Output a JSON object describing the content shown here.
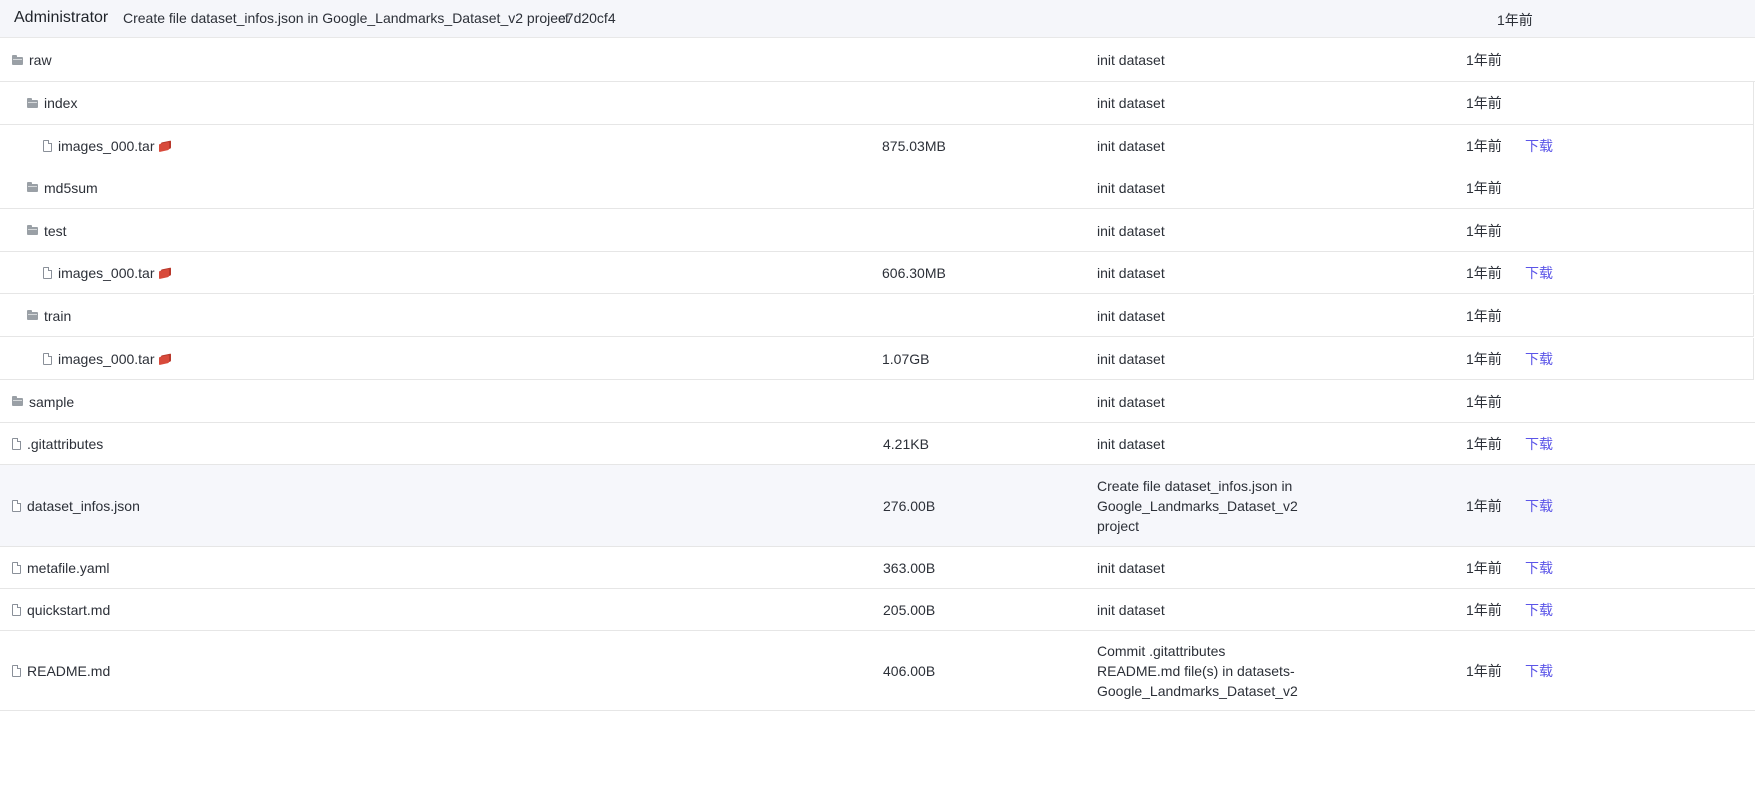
{
  "latest_commit": {
    "author": "Administrator",
    "message": "Create file dataset_infos.json in Google_Landmarks_Dataset_v2 project",
    "hash": "e7d20cf4",
    "time": "1年前"
  },
  "download_label": "下载",
  "rows": [
    {
      "type": "folder",
      "level": 0,
      "name": "raw",
      "size": "",
      "commit": "init dataset",
      "time": "1年前",
      "download": false
    },
    {
      "type": "folder",
      "level": 1,
      "name": "index",
      "size": "",
      "commit": "init dataset",
      "time": "1年前",
      "download": false
    },
    {
      "type": "file",
      "level": 2,
      "name": "images_000.tar",
      "lfs": true,
      "size": "875.03MB",
      "commit": "init dataset",
      "time": "1年前",
      "download": true
    },
    {
      "type": "folder",
      "level": 1,
      "name": "md5sum",
      "size": "",
      "commit": "init dataset",
      "time": "1年前",
      "download": false
    },
    {
      "type": "folder",
      "level": 1,
      "name": "test",
      "size": "",
      "commit": "init dataset",
      "time": "1年前",
      "download": false
    },
    {
      "type": "file",
      "level": 2,
      "name": "images_000.tar",
      "lfs": true,
      "size": "606.30MB",
      "commit": "init dataset",
      "time": "1年前",
      "download": true
    },
    {
      "type": "folder",
      "level": 1,
      "name": "train",
      "size": "",
      "commit": "init dataset",
      "time": "1年前",
      "download": false
    },
    {
      "type": "file",
      "level": 2,
      "name": "images_000.tar",
      "lfs": true,
      "size": "1.07GB",
      "commit": "init dataset",
      "time": "1年前",
      "download": true
    },
    {
      "type": "folder",
      "level": 0,
      "name": "sample",
      "size": "",
      "commit": "init dataset",
      "time": "1年前",
      "download": false
    },
    {
      "type": "file",
      "level": 0,
      "name": ".gitattributes",
      "size": "4.21KB",
      "commit": "init dataset",
      "time": "1年前",
      "download": true
    },
    {
      "type": "file",
      "level": 0,
      "name": "dataset_infos.json",
      "size": "276.00B",
      "commit": "Create file dataset_infos.json in Google_Landmarks_Dataset_v2 project",
      "time": "1年前",
      "download": true,
      "highlight": true
    },
    {
      "type": "file",
      "level": 0,
      "name": "metafile.yaml",
      "size": "363.00B",
      "commit": "init dataset",
      "time": "1年前",
      "download": true
    },
    {
      "type": "file",
      "level": 0,
      "name": "quickstart.md",
      "size": "205.00B",
      "commit": "init dataset",
      "time": "1年前",
      "download": true
    },
    {
      "type": "file",
      "level": 0,
      "name": "README.md",
      "size": "406.00B",
      "commit": "Commit .gitattributes README.md file(s) in datasets-Google_Landmarks_Dataset_v2",
      "time": "1年前",
      "download": true
    }
  ]
}
